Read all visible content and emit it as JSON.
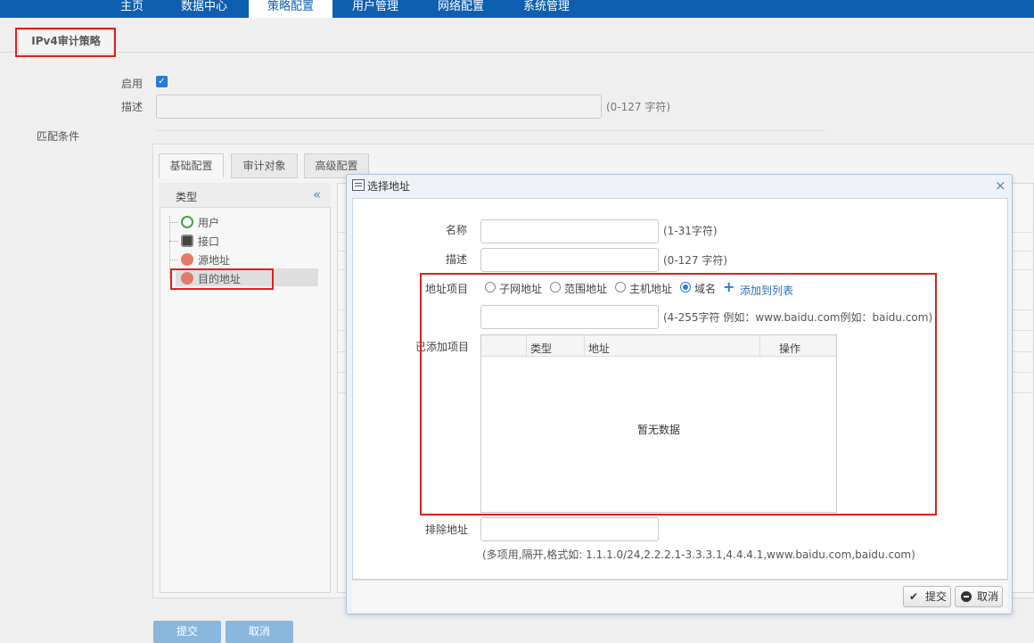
{
  "nav": {
    "items": [
      "主页",
      "数据中心",
      "策略配置",
      "用户管理",
      "网络配置",
      "系统管理"
    ],
    "active_index": 2
  },
  "page_tab": "IPv4审计策略",
  "form": {
    "enable_label": "启用",
    "enable_checked": true,
    "desc_label": "描述",
    "desc_hint": "(0-127 字符)",
    "match_label": "匹配条件"
  },
  "match_tabs": [
    "基础配置",
    "审计对象",
    "高级配置"
  ],
  "left_panel": {
    "header": "类型",
    "collapse_icon": "«",
    "tree_items": [
      "用户",
      "接口",
      "源地址",
      "目的地址"
    ],
    "selected_index": 3
  },
  "bottom_buttons": {
    "submit": "提交",
    "cancel": "取消"
  },
  "dialog": {
    "title": "选择地址",
    "name_label": "名称",
    "name_hint": "(1-31字符)",
    "desc_label": "描述",
    "desc_hint": "(0-127 字符)",
    "addr_item_label": "地址项目",
    "radio_options": [
      "子网地址",
      "范围地址",
      "主机地址",
      "域名"
    ],
    "radio_selected": 3,
    "add_to_list": "添加到列表",
    "domain_hint": "(4-255字符 例如：www.baidu.com例如：baidu.com)",
    "added_label": "已添加项目",
    "table_headers": [
      "类型",
      "地址",
      "操作"
    ],
    "empty_text": "暂无数据",
    "exclude_label": "排除地址",
    "exclude_hint": "(多项用,隔开,格式如: 1.1.1.0/24,2.2.2.1-3.3.3.1,4.4.4.1,www.baidu.com,baidu.com)",
    "submit": "提交",
    "cancel": "取消",
    "close": "×"
  },
  "colors": {
    "nav_bg": "#0f5fb0",
    "accent": "#2b7bd5",
    "highlight_box": "#e01f1f"
  }
}
